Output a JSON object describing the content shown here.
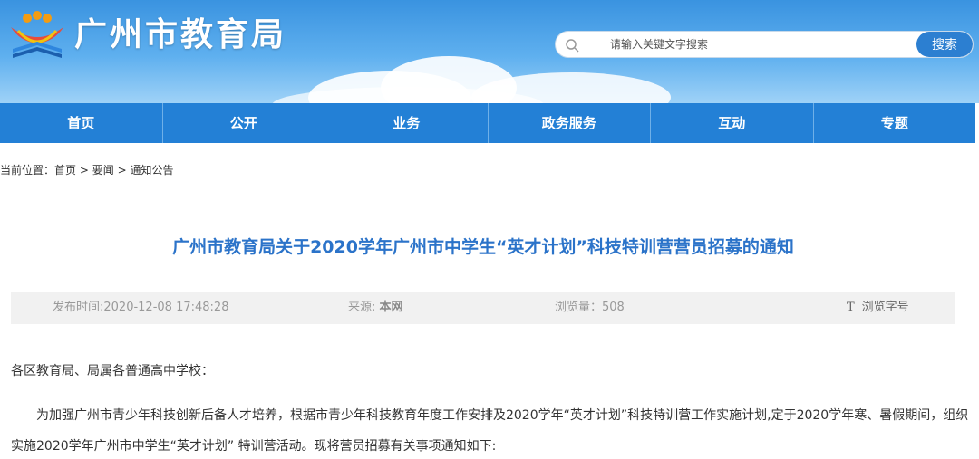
{
  "site": {
    "title": "广州市教育局",
    "colors": {
      "nav": "#2380d6",
      "title": "#2b73c9",
      "search_button": "#2c7fd1"
    }
  },
  "search": {
    "placeholder": "请输入关键文字搜索",
    "button_label": "搜索"
  },
  "nav": {
    "items": [
      "首页",
      "公开",
      "业务",
      "政务服务",
      "互动",
      "专题"
    ]
  },
  "breadcrumb": {
    "prefix": "当前位置：",
    "items": [
      "首页",
      "要闻",
      "通知公告"
    ],
    "separator": ">"
  },
  "article": {
    "title": "广州市教育局关于2020学年广州市中学生“英才计划”科技特训营营员招募的通知",
    "meta": {
      "publish_label": "发布时间:",
      "publish_time": "2020-12-08 17:48:28",
      "source_label": "来源: ",
      "source": "本网",
      "views_label": "浏览量：",
      "views": "508",
      "font_icon": "T",
      "font_label": "浏览字号"
    },
    "greeting": "各区教育局、局属各普通高中学校：",
    "paragraph": "为加强广州市青少年科技创新后备人才培养，根据市青少年科技教育年度工作安排及2020学年“英才计划”科技特训营工作实施计划,定于2020学年寒、暑假期间，组织实施2020学年广州市中学生“英才计划” 特训营活动。现将营员招募有关事项通知如下:"
  }
}
